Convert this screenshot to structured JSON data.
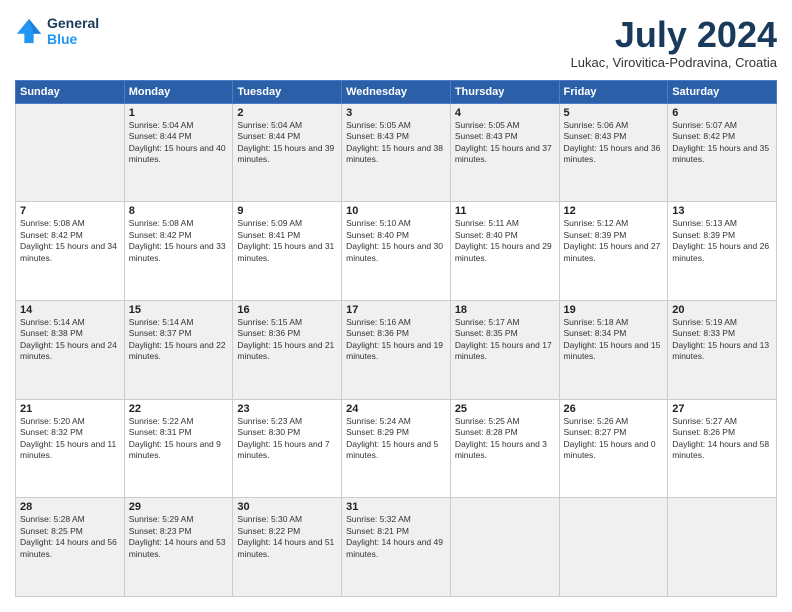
{
  "logo": {
    "line1": "General",
    "line2": "Blue"
  },
  "title": "July 2024",
  "location": "Lukac, Virovitica-Podravina, Croatia",
  "days_header": [
    "Sunday",
    "Monday",
    "Tuesday",
    "Wednesday",
    "Thursday",
    "Friday",
    "Saturday"
  ],
  "weeks": [
    [
      {
        "day": "",
        "sunrise": "",
        "sunset": "",
        "daylight": ""
      },
      {
        "day": "1",
        "sunrise": "Sunrise: 5:04 AM",
        "sunset": "Sunset: 8:44 PM",
        "daylight": "Daylight: 15 hours and 40 minutes."
      },
      {
        "day": "2",
        "sunrise": "Sunrise: 5:04 AM",
        "sunset": "Sunset: 8:44 PM",
        "daylight": "Daylight: 15 hours and 39 minutes."
      },
      {
        "day": "3",
        "sunrise": "Sunrise: 5:05 AM",
        "sunset": "Sunset: 8:43 PM",
        "daylight": "Daylight: 15 hours and 38 minutes."
      },
      {
        "day": "4",
        "sunrise": "Sunrise: 5:05 AM",
        "sunset": "Sunset: 8:43 PM",
        "daylight": "Daylight: 15 hours and 37 minutes."
      },
      {
        "day": "5",
        "sunrise": "Sunrise: 5:06 AM",
        "sunset": "Sunset: 8:43 PM",
        "daylight": "Daylight: 15 hours and 36 minutes."
      },
      {
        "day": "6",
        "sunrise": "Sunrise: 5:07 AM",
        "sunset": "Sunset: 8:42 PM",
        "daylight": "Daylight: 15 hours and 35 minutes."
      }
    ],
    [
      {
        "day": "7",
        "sunrise": "Sunrise: 5:08 AM",
        "sunset": "Sunset: 8:42 PM",
        "daylight": "Daylight: 15 hours and 34 minutes."
      },
      {
        "day": "8",
        "sunrise": "Sunrise: 5:08 AM",
        "sunset": "Sunset: 8:42 PM",
        "daylight": "Daylight: 15 hours and 33 minutes."
      },
      {
        "day": "9",
        "sunrise": "Sunrise: 5:09 AM",
        "sunset": "Sunset: 8:41 PM",
        "daylight": "Daylight: 15 hours and 31 minutes."
      },
      {
        "day": "10",
        "sunrise": "Sunrise: 5:10 AM",
        "sunset": "Sunset: 8:40 PM",
        "daylight": "Daylight: 15 hours and 30 minutes."
      },
      {
        "day": "11",
        "sunrise": "Sunrise: 5:11 AM",
        "sunset": "Sunset: 8:40 PM",
        "daylight": "Daylight: 15 hours and 29 minutes."
      },
      {
        "day": "12",
        "sunrise": "Sunrise: 5:12 AM",
        "sunset": "Sunset: 8:39 PM",
        "daylight": "Daylight: 15 hours and 27 minutes."
      },
      {
        "day": "13",
        "sunrise": "Sunrise: 5:13 AM",
        "sunset": "Sunset: 8:39 PM",
        "daylight": "Daylight: 15 hours and 26 minutes."
      }
    ],
    [
      {
        "day": "14",
        "sunrise": "Sunrise: 5:14 AM",
        "sunset": "Sunset: 8:38 PM",
        "daylight": "Daylight: 15 hours and 24 minutes."
      },
      {
        "day": "15",
        "sunrise": "Sunrise: 5:14 AM",
        "sunset": "Sunset: 8:37 PM",
        "daylight": "Daylight: 15 hours and 22 minutes."
      },
      {
        "day": "16",
        "sunrise": "Sunrise: 5:15 AM",
        "sunset": "Sunset: 8:36 PM",
        "daylight": "Daylight: 15 hours and 21 minutes."
      },
      {
        "day": "17",
        "sunrise": "Sunrise: 5:16 AM",
        "sunset": "Sunset: 8:36 PM",
        "daylight": "Daylight: 15 hours and 19 minutes."
      },
      {
        "day": "18",
        "sunrise": "Sunrise: 5:17 AM",
        "sunset": "Sunset: 8:35 PM",
        "daylight": "Daylight: 15 hours and 17 minutes."
      },
      {
        "day": "19",
        "sunrise": "Sunrise: 5:18 AM",
        "sunset": "Sunset: 8:34 PM",
        "daylight": "Daylight: 15 hours and 15 minutes."
      },
      {
        "day": "20",
        "sunrise": "Sunrise: 5:19 AM",
        "sunset": "Sunset: 8:33 PM",
        "daylight": "Daylight: 15 hours and 13 minutes."
      }
    ],
    [
      {
        "day": "21",
        "sunrise": "Sunrise: 5:20 AM",
        "sunset": "Sunset: 8:32 PM",
        "daylight": "Daylight: 15 hours and 11 minutes."
      },
      {
        "day": "22",
        "sunrise": "Sunrise: 5:22 AM",
        "sunset": "Sunset: 8:31 PM",
        "daylight": "Daylight: 15 hours and 9 minutes."
      },
      {
        "day": "23",
        "sunrise": "Sunrise: 5:23 AM",
        "sunset": "Sunset: 8:30 PM",
        "daylight": "Daylight: 15 hours and 7 minutes."
      },
      {
        "day": "24",
        "sunrise": "Sunrise: 5:24 AM",
        "sunset": "Sunset: 8:29 PM",
        "daylight": "Daylight: 15 hours and 5 minutes."
      },
      {
        "day": "25",
        "sunrise": "Sunrise: 5:25 AM",
        "sunset": "Sunset: 8:28 PM",
        "daylight": "Daylight: 15 hours and 3 minutes."
      },
      {
        "day": "26",
        "sunrise": "Sunrise: 5:26 AM",
        "sunset": "Sunset: 8:27 PM",
        "daylight": "Daylight: 15 hours and 0 minutes."
      },
      {
        "day": "27",
        "sunrise": "Sunrise: 5:27 AM",
        "sunset": "Sunset: 8:26 PM",
        "daylight": "Daylight: 14 hours and 58 minutes."
      }
    ],
    [
      {
        "day": "28",
        "sunrise": "Sunrise: 5:28 AM",
        "sunset": "Sunset: 8:25 PM",
        "daylight": "Daylight: 14 hours and 56 minutes."
      },
      {
        "day": "29",
        "sunrise": "Sunrise: 5:29 AM",
        "sunset": "Sunset: 8:23 PM",
        "daylight": "Daylight: 14 hours and 53 minutes."
      },
      {
        "day": "30",
        "sunrise": "Sunrise: 5:30 AM",
        "sunset": "Sunset: 8:22 PM",
        "daylight": "Daylight: 14 hours and 51 minutes."
      },
      {
        "day": "31",
        "sunrise": "Sunrise: 5:32 AM",
        "sunset": "Sunset: 8:21 PM",
        "daylight": "Daylight: 14 hours and 49 minutes."
      },
      {
        "day": "",
        "sunrise": "",
        "sunset": "",
        "daylight": ""
      },
      {
        "day": "",
        "sunrise": "",
        "sunset": "",
        "daylight": ""
      },
      {
        "day": "",
        "sunrise": "",
        "sunset": "",
        "daylight": ""
      }
    ]
  ]
}
